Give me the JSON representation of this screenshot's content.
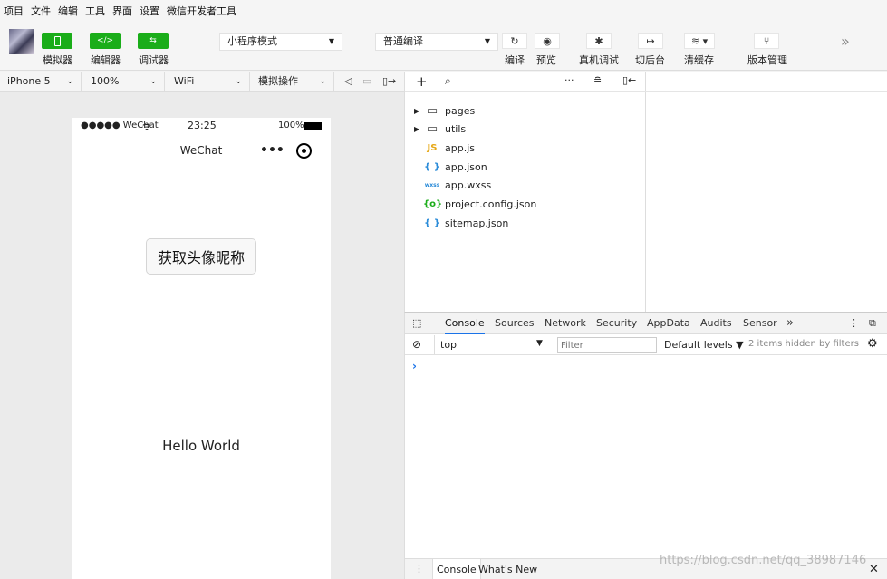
{
  "menu": [
    "项目",
    "文件",
    "编辑",
    "工具",
    "界面",
    "设置",
    "微信开发者工具"
  ],
  "toolbar": {
    "simulator_label": "模拟器",
    "editor_label": "编辑器",
    "debugger_label": "调试器",
    "mode_select": "小程序模式",
    "compile_select": "普通编译",
    "compile_label": "编译",
    "preview_label": "预览",
    "remote_debug_label": "真机调试",
    "background_label": "切后台",
    "clear_cache_label": "清缓存",
    "version_label": "版本管理",
    "more": "»",
    "editor_glyph": "</>",
    "debugger_glyph": "⇆",
    "icon_glyphs": {
      "compile": "↻",
      "preview": "◉",
      "remote_debug": "✱",
      "background": "↦",
      "clear_cache": "≋ ▾",
      "version": "⑂"
    },
    "accent_color": "#1aad19"
  },
  "device_bar": {
    "device": "iPhone 5",
    "zoom": "100%",
    "network": "WiFi",
    "operation": "模拟操作"
  },
  "phone": {
    "signal": "●●●●● WeChat",
    "time": "23:25",
    "battery": "100%",
    "title": "WeChat",
    "menu_dots": "•••",
    "button": "获取头像昵称",
    "hello": "Hello World"
  },
  "file_tree": {
    "items": [
      {
        "name": "pages",
        "icon": "folder-icon",
        "glyph": "▭",
        "folder": true
      },
      {
        "name": "utils",
        "icon": "folder-icon",
        "glyph": "▭",
        "folder": true
      },
      {
        "name": "app.js",
        "icon": "js-icon",
        "glyph": "JS",
        "folder": false
      },
      {
        "name": "app.json",
        "icon": "json-icon",
        "glyph": "{ }",
        "folder": false
      },
      {
        "name": "app.wxss",
        "icon": "wxss-icon",
        "glyph": "wxss",
        "folder": false
      },
      {
        "name": "project.config.json",
        "icon": "config-icon",
        "glyph": "{o}",
        "folder": false
      },
      {
        "name": "sitemap.json",
        "icon": "json-icon",
        "glyph": "{ }",
        "folder": false
      }
    ]
  },
  "devtools": {
    "tabs": [
      "Console",
      "Sources",
      "Network",
      "Security",
      "AppData",
      "Audits",
      "Sensor"
    ],
    "context": "top",
    "filter_placeholder": "Filter",
    "levels": "Default levels ▼",
    "hidden": "2 items hidden by filters",
    "prompt": "›",
    "drawer_tabs": [
      "Console",
      "What's New"
    ]
  },
  "watermark": "https://blog.csdn.net/qq_38987146"
}
